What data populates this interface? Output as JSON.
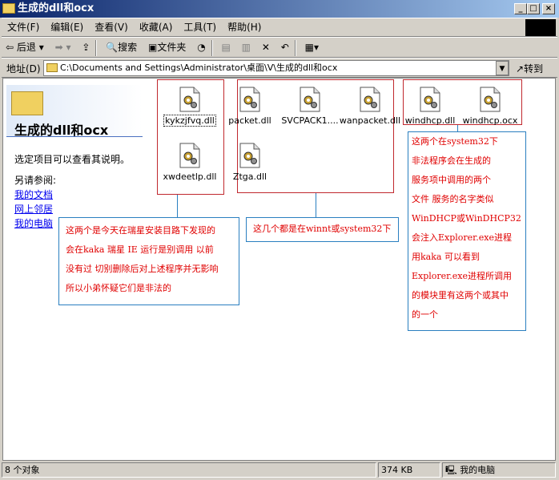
{
  "window": {
    "title": "生成的dll和ocx"
  },
  "menu": [
    "文件(F)",
    "编辑(E)",
    "查看(V)",
    "收藏(A)",
    "工具(T)",
    "帮助(H)"
  ],
  "toolbar": {
    "back": "后退",
    "search": "搜索",
    "folders": "文件夹"
  },
  "address": {
    "label": "地址(D)",
    "value": "C:\\Documents and Settings\\Administrator\\桌面\\V\\生成的dll和ocx",
    "go": "转到"
  },
  "left_panel": {
    "title": "生成的dll和ocx",
    "hint": "选定项目可以查看其说明。",
    "see_also": "另请参阅:",
    "links": [
      "我的文档",
      "网上邻居",
      "我的电脑"
    ]
  },
  "files": [
    "kykzjfvq.dll",
    "xwdeetlp.dll",
    "packet.dll",
    "SVCPACK1....",
    "wanpacket.dll",
    "Ztga.dll",
    "windhcp.dll",
    "windhcp.ocx"
  ],
  "notes": {
    "left": [
      "这两个是今天在瑞星安装目路下发现的",
      "会在kaka 瑞星 IE 运行是别调用 以前",
      "没有过 切别删除后对上述程序并无影响",
      "所以小弟怀疑它们是非法的"
    ],
    "middle": [
      "这几个都是在winnt或system32下"
    ],
    "right": [
      "这两个在system32下",
      "非法程序会在生成的",
      "服务项中调用的两个",
      "文件 服务的名字类似",
      "WinDHCP或WinDHCP32",
      "会注入Explorer.exe进程",
      "用kaka 可以看到",
      "Explorer.exe进程所调用",
      "的模块里有这两个或其中",
      "的一个"
    ]
  },
  "status": {
    "count": "8 个对象",
    "size": "374 KB",
    "location": "我的电脑"
  }
}
